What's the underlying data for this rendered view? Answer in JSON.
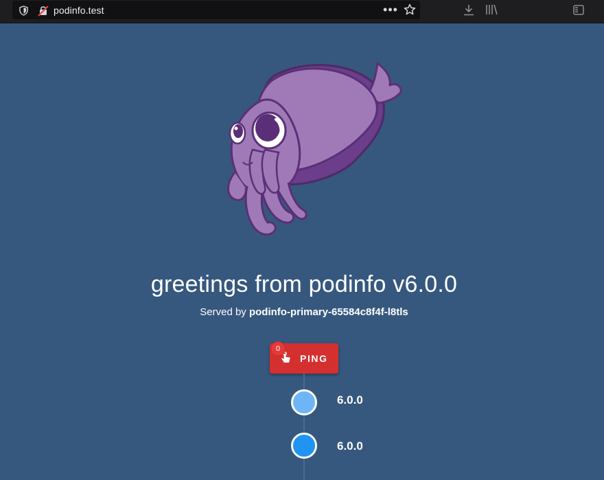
{
  "browser": {
    "url": "podinfo.test",
    "icons": [
      "shield-icon",
      "insecure-lock-icon",
      "more-dots-icon",
      "bookmark-star-icon",
      "download-icon",
      "library-icon",
      "sidebar-icon"
    ]
  },
  "page": {
    "title": "greetings from podinfo v6.0.0",
    "served_prefix": "Served by ",
    "served_host": "podinfo-primary-65584c8f4f-l8tls"
  },
  "ping": {
    "label": "PING",
    "count": "0"
  },
  "timeline": [
    {
      "label": "6.0.0",
      "color": "#6db5f6"
    },
    {
      "label": "6.0.0",
      "color": "#2194f3"
    }
  ],
  "colors": {
    "background": "#36587e",
    "button": "#d4302f",
    "mascot": "#9f7ab6"
  }
}
